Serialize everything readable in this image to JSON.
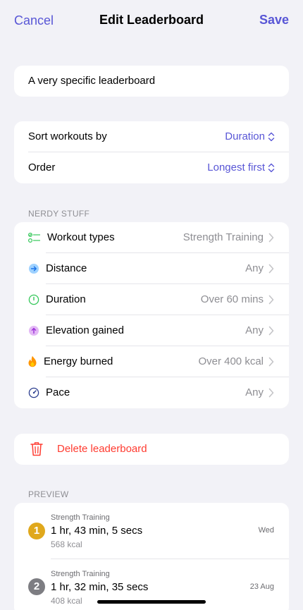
{
  "nav": {
    "cancel_label": "Cancel",
    "title": "Edit Leaderboard",
    "save_label": "Save"
  },
  "name_field": {
    "value": "A very specific leaderboard"
  },
  "sort": {
    "sort_by_label": "Sort workouts by",
    "sort_by_value": "Duration",
    "order_label": "Order",
    "order_value": "Longest first"
  },
  "nerdy": {
    "header": "NERDY STUFF",
    "rows": [
      {
        "label": "Workout types",
        "value": "Strength Training",
        "icon": "checklist-icon"
      },
      {
        "label": "Distance",
        "value": "Any",
        "icon": "arrow-right-circle-icon"
      },
      {
        "label": "Duration",
        "value": "Over 60 mins",
        "icon": "timer-icon"
      },
      {
        "label": "Elevation gained",
        "value": "Any",
        "icon": "arrow-up-circle-icon"
      },
      {
        "label": "Energy burned",
        "value": "Over 400 kcal",
        "icon": "flame-icon"
      },
      {
        "label": "Pace",
        "value": "Any",
        "icon": "speedometer-icon"
      }
    ]
  },
  "delete": {
    "label": "Delete leaderboard"
  },
  "preview": {
    "header": "PREVIEW",
    "entries": [
      {
        "rank": "1",
        "type": "Strength Training",
        "duration": "1 hr, 43 min, 5 secs",
        "energy": "568 kcal",
        "date": "Wed"
      },
      {
        "rank": "2",
        "type": "Strength Training",
        "duration": "1 hr, 32 min, 35 secs",
        "energy": "408 kcal",
        "date": "23 Aug"
      }
    ]
  },
  "colors": {
    "accent": "#5856d6",
    "destructive": "#ff3b30",
    "gold": "#e0a81c",
    "silver": "#7d7d82",
    "background": "#f2f2f7"
  }
}
